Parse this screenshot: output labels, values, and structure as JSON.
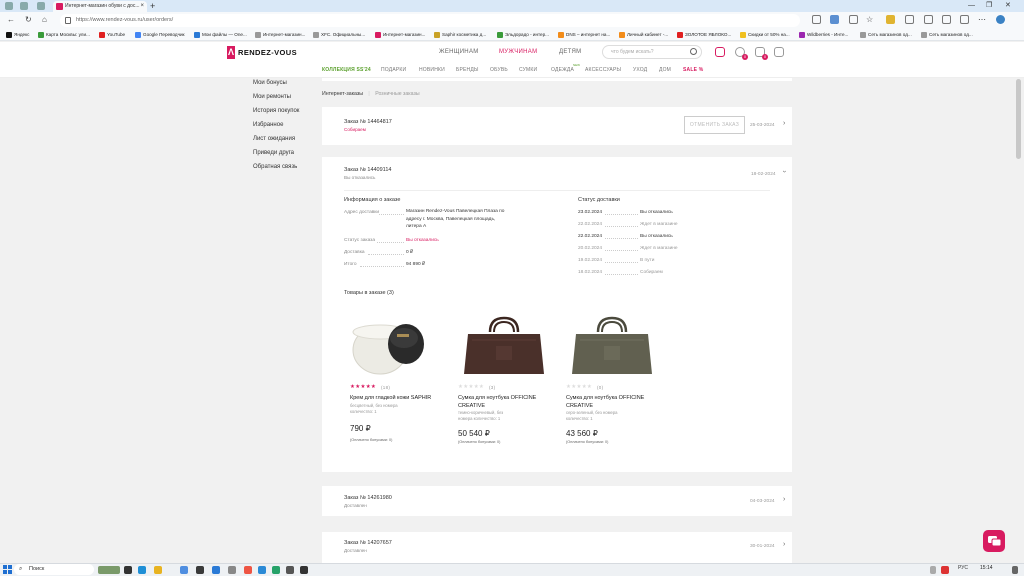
{
  "browser": {
    "tab_title": "Интернет-магазин обуви с дос...",
    "url": "https://www.rendez-vous.ru/user/orders/",
    "bookmarks": [
      "Яндекс",
      "Карта Москвы: ули...",
      "YouTube",
      "Google Переводчик",
      "Мои файлы — One...",
      "Интернет-магазин...",
      "XFC. Официальны...",
      "Интернет-магазин...",
      "Saphir косметика д...",
      "Эльдорадо - интер...",
      "DNS – интернет на...",
      "Личный кабинет -...",
      "ЗОЛОТОЕ ЯБЛОКО...",
      "Скидки от 50% на...",
      "Wildberries - Инте...",
      "Сеть магазинов од...",
      "Сеть магазинов од..."
    ]
  },
  "header": {
    "logo_text": "RENDEZ-VOUS",
    "nav": [
      "ЖЕНЩИНАМ",
      "МУЖЧИНАМ",
      "ДЕТЯМ"
    ],
    "search_placeholder": "что будем искать?",
    "badges": [
      "0",
      "0"
    ],
    "categories": [
      "КОЛЛЕКЦИЯ SS'24",
      "ПОДАРКИ",
      "НОВИНКИ",
      "БРЕНДЫ",
      "ОБУВЬ",
      "СУМКИ",
      "ОДЕЖДА",
      "АКСЕССУАРЫ",
      "УХОД",
      "ДОМ",
      "SALE %"
    ],
    "new_badge": "NEW"
  },
  "sidebar": [
    "Мои бонусы",
    "Мои ремонты",
    "История покупок",
    "Избранное",
    "Лист ожидания",
    "Приведи друга",
    "Обратная связь"
  ],
  "subtabs": [
    "Интернет-заказы",
    "Розничные заказы"
  ],
  "orders": [
    {
      "label": "Заказ № 14464817",
      "status": "Собираем",
      "date": "25-03-2024",
      "cancel": "ОТМЕНИТЬ ЗАКАЗ"
    },
    {
      "label": "Заказ № 14409114",
      "status": "Вы отказались",
      "date": "18-02-2024"
    },
    {
      "label": "Заказ № 14261980",
      "status": "Доставлен",
      "date": "04-03-2024"
    },
    {
      "label": "Заказ № 14207657",
      "status": "Доставлен",
      "date": "30-01-2024"
    }
  ],
  "details": {
    "info_title": "Информация о заказе",
    "rows": [
      {
        "k": "Адрес доставки",
        "v": "Магазин Rendez-Vous Павелецкая Плаза по адресу г. Москва, Павелецкая площадь, литера А"
      },
      {
        "k": "Статус заказа",
        "v": "Вы отказались"
      },
      {
        "k": "Доставка",
        "v": "0 ₽"
      },
      {
        "k": "Итого",
        "v": "94 890 ₽"
      }
    ],
    "status_title": "Статус доставки",
    "status_history": [
      {
        "date": "23.02.2024",
        "status": "Вы отказались"
      },
      {
        "date": "22.02.2024",
        "status": "Ждет в магазине"
      },
      {
        "date": "22.02.2024",
        "status": "Вы отказались"
      },
      {
        "date": "20.02.2024",
        "status": "Ждет в магазине"
      },
      {
        "date": "19.02.2024",
        "status": "В пути"
      },
      {
        "date": "18.02.2024",
        "status": "Собираем"
      }
    ],
    "goods_title": "Товары в заказе (3)",
    "products": [
      {
        "reviews": "(18)",
        "name": "Крем для гладкой кожи SAPHIR",
        "meta": "бесцветный, без номера количество: 1",
        "price": "790 ₽",
        "note": "(Оплачено бонусами: 0)",
        "rating": 5
      },
      {
        "reviews": "(3)",
        "name": "Сумка для ноутбука OFFICINE CREATIVE",
        "meta": "темно-коричневый, без номера количество: 1",
        "price": "50 540 ₽",
        "note": "(Оплачено бонусами: 0)",
        "rating": 0
      },
      {
        "reviews": "(0)",
        "name": "Сумка для ноутбука OFFICINE CREATIVE",
        "meta": "серо-зеленый, без номера количество: 1",
        "price": "43 560 ₽",
        "note": "(Оплачено бонусами: 0)",
        "rating": 0
      }
    ]
  },
  "taskbar": {
    "search": "Поиск",
    "time": "15:14",
    "lang": "РУС"
  },
  "colors": {
    "accent": "#d81b60",
    "green": "#5aa02c"
  }
}
